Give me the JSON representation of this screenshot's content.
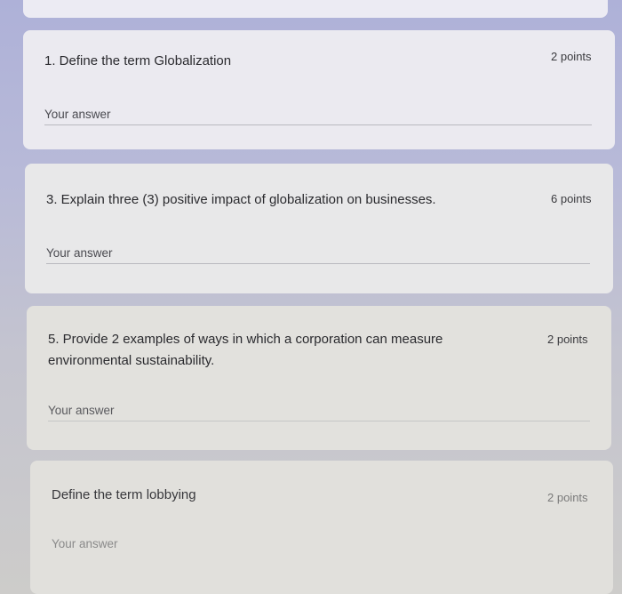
{
  "questions": [
    {
      "title": "1. Define the term Globalization",
      "points": "2 points",
      "answer_placeholder": "Your answer"
    },
    {
      "title": "3. Explain three (3) positive impact of globalization on businesses.",
      "points": "6 points",
      "answer_placeholder": "Your answer"
    },
    {
      "title": "5. Provide 2 examples of ways in which a corporation can measure environmental sustainability.",
      "points": "2 points",
      "answer_placeholder": "Your answer"
    },
    {
      "title": "Define the term lobbying",
      "points": "2 points",
      "answer_placeholder": "Your answer"
    }
  ]
}
